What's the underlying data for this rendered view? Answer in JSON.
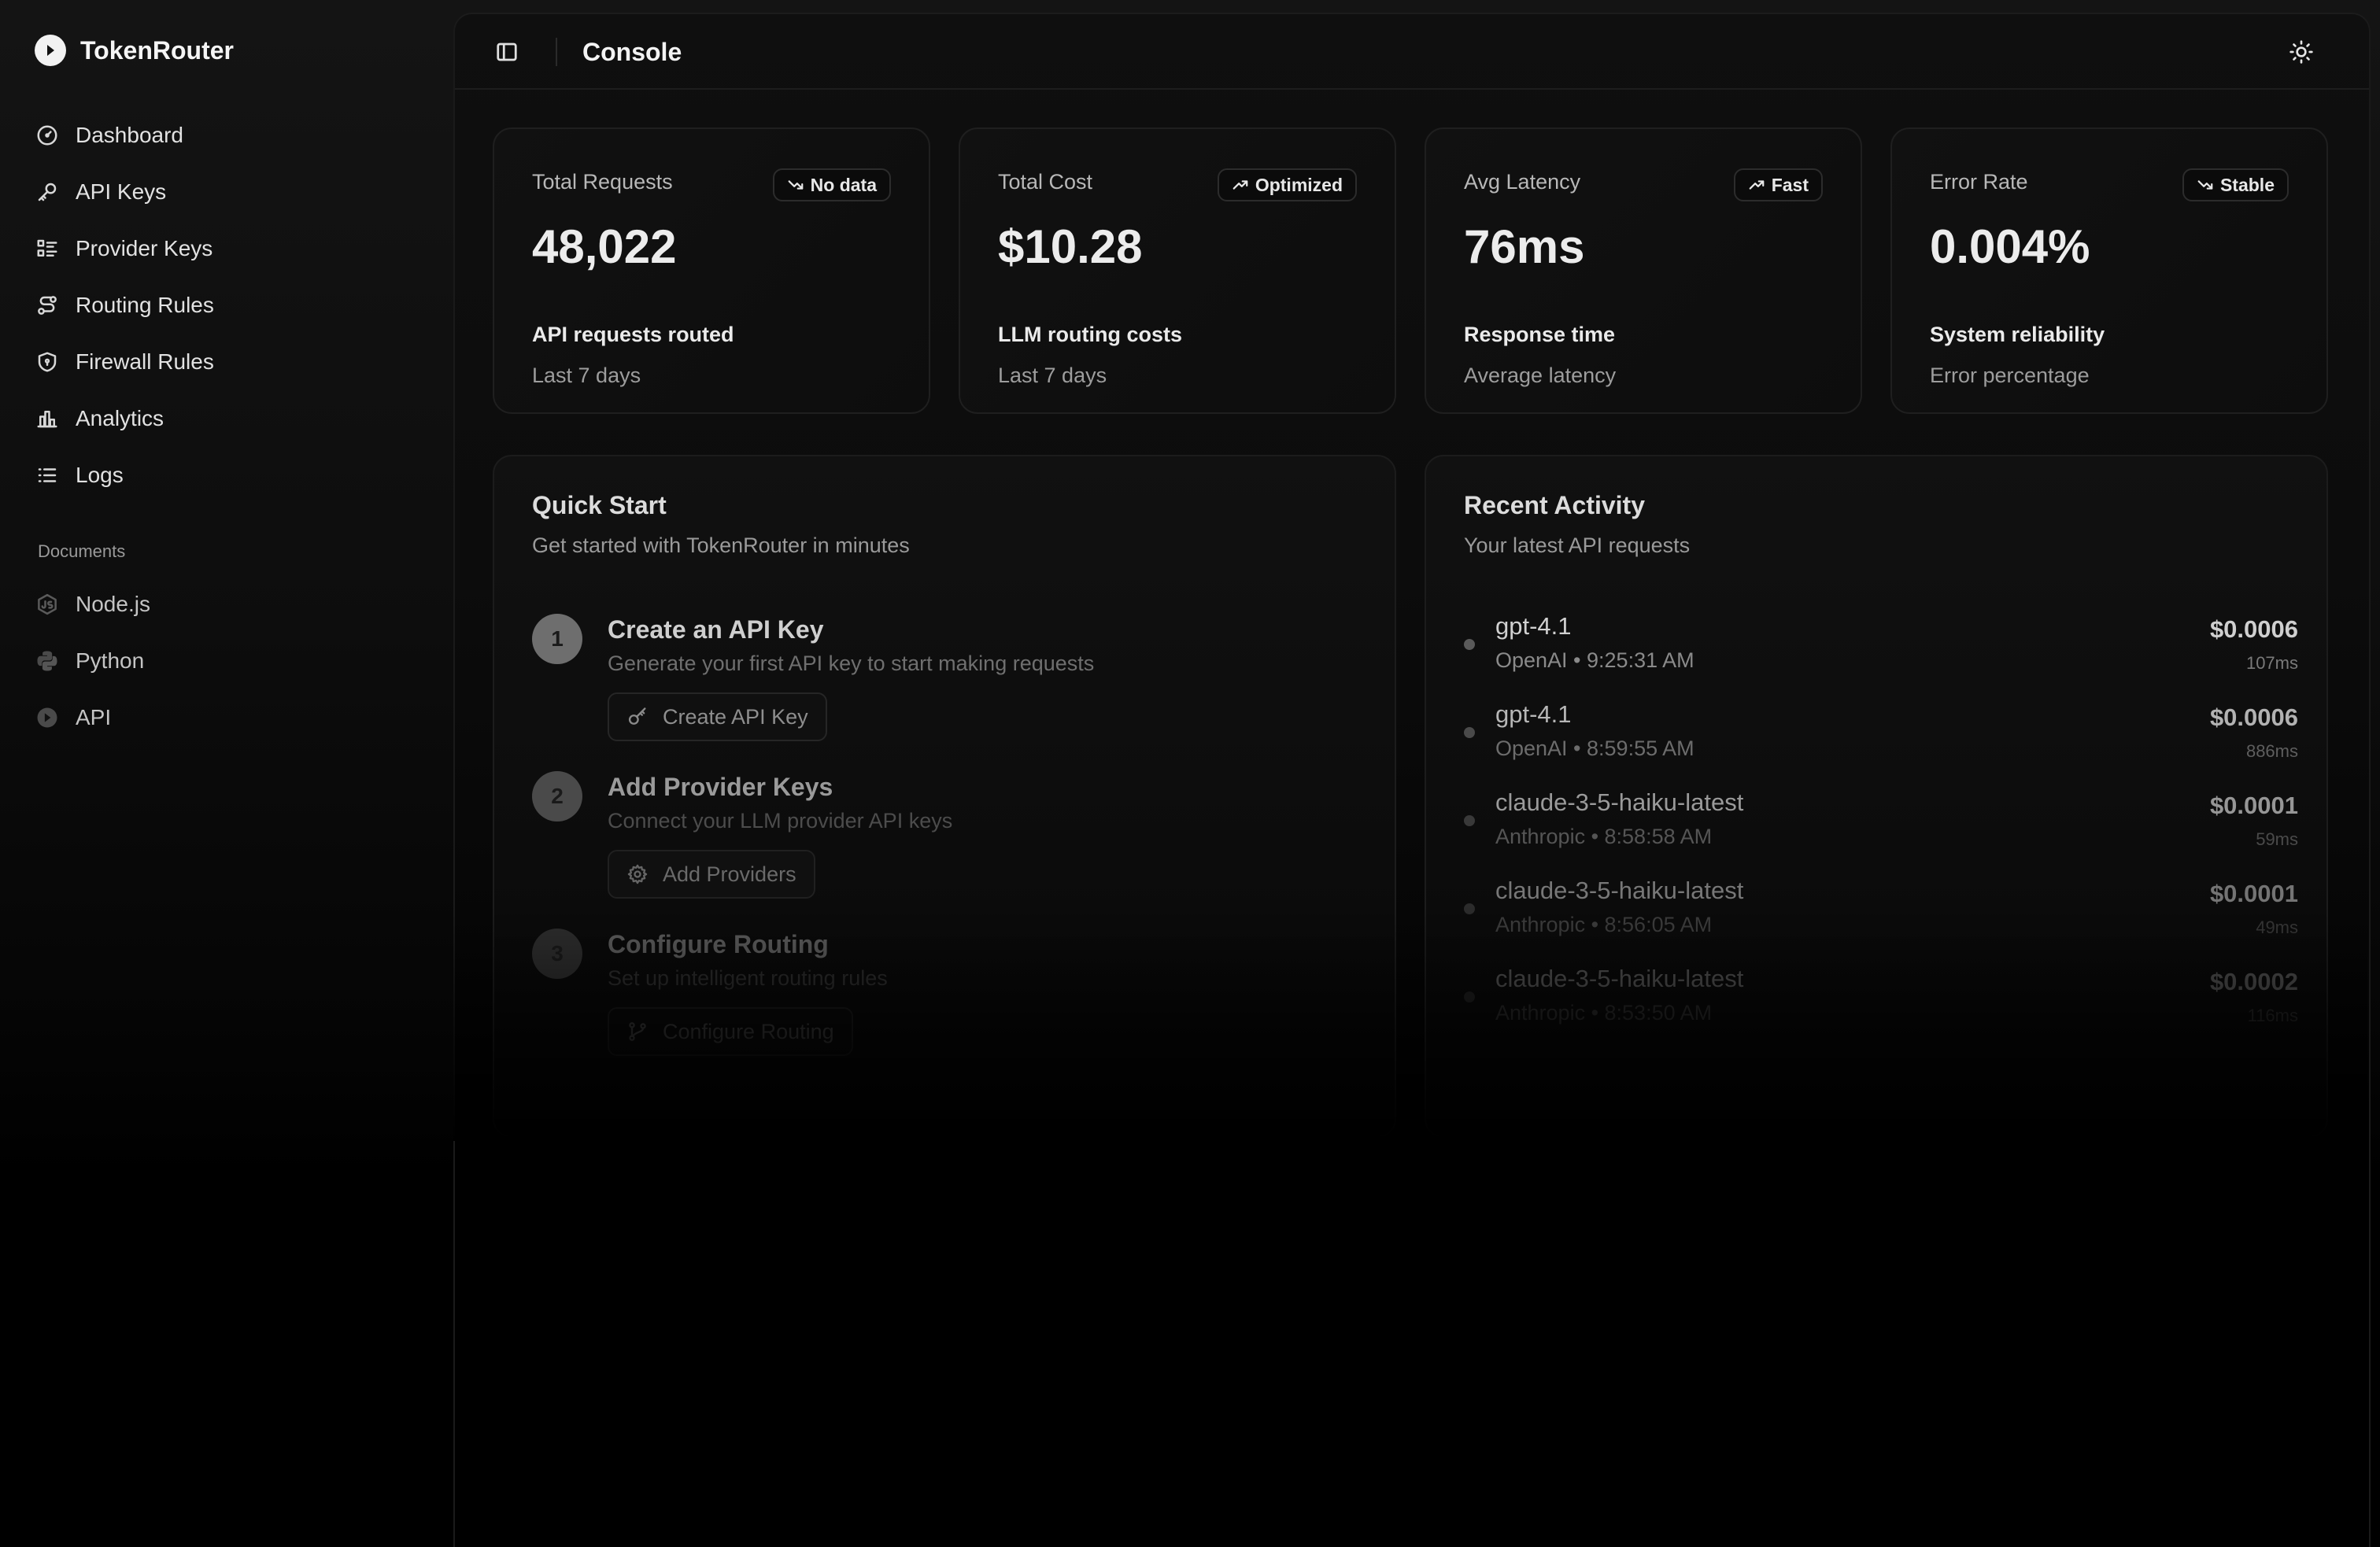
{
  "brand": {
    "name": "TokenRouter"
  },
  "sidebar": {
    "items": [
      {
        "label": "Dashboard",
        "icon": "gauge-icon"
      },
      {
        "label": "API Keys",
        "icon": "key-icon"
      },
      {
        "label": "Provider Keys",
        "icon": "list-key-icon"
      },
      {
        "label": "Routing Rules",
        "icon": "route-icon"
      },
      {
        "label": "Firewall Rules",
        "icon": "shield-icon"
      },
      {
        "label": "Analytics",
        "icon": "bar-chart-icon"
      },
      {
        "label": "Logs",
        "icon": "list-icon"
      }
    ],
    "documents_label": "Documents",
    "documents": [
      {
        "label": "Node.js",
        "icon": "nodejs-icon"
      },
      {
        "label": "Python",
        "icon": "python-icon"
      },
      {
        "label": "API",
        "icon": "api-icon"
      }
    ]
  },
  "header": {
    "title": "Console"
  },
  "stats": [
    {
      "label": "Total Requests",
      "badge": "No data",
      "badge_icon": "trend-down-icon",
      "value": "48,022",
      "desc": "API requests routed",
      "sub": "Last 7 days"
    },
    {
      "label": "Total Cost",
      "badge": "Optimized",
      "badge_icon": "trend-up-icon",
      "value": "$10.28",
      "desc": "LLM routing costs",
      "sub": "Last 7 days"
    },
    {
      "label": "Avg Latency",
      "badge": "Fast",
      "badge_icon": "trend-up-icon",
      "value": "76ms",
      "desc": "Response time",
      "sub": "Average latency"
    },
    {
      "label": "Error Rate",
      "badge": "Stable",
      "badge_icon": "trend-down-icon",
      "value": "0.004%",
      "desc": "System reliability",
      "sub": "Error percentage"
    }
  ],
  "quick_start": {
    "title": "Quick Start",
    "subtitle": "Get started with TokenRouter in minutes",
    "steps": [
      {
        "num": "1",
        "title": "Create an API Key",
        "desc": "Generate your first API key to start making requests",
        "button": "Create API Key",
        "icon": "key-icon"
      },
      {
        "num": "2",
        "title": "Add Provider Keys",
        "desc": "Connect your LLM provider API keys",
        "button": "Add Providers",
        "icon": "gear-icon"
      },
      {
        "num": "3",
        "title": "Configure Routing",
        "desc": "Set up intelligent routing rules",
        "button": "Configure Routing",
        "icon": "git-branch-icon"
      }
    ]
  },
  "recent_activity": {
    "title": "Recent Activity",
    "subtitle": "Your latest API requests",
    "rows": [
      {
        "model": "gpt-4.1",
        "meta": "OpenAI • 9:25:31 AM",
        "cost": "$0.0006",
        "latency": "107ms"
      },
      {
        "model": "gpt-4.1",
        "meta": "OpenAI • 8:59:55 AM",
        "cost": "$0.0006",
        "latency": "886ms"
      },
      {
        "model": "claude-3-5-haiku-latest",
        "meta": "Anthropic • 8:58:58 AM",
        "cost": "$0.0001",
        "latency": "59ms"
      },
      {
        "model": "claude-3-5-haiku-latest",
        "meta": "Anthropic • 8:56:05 AM",
        "cost": "$0.0001",
        "latency": "49ms"
      },
      {
        "model": "claude-3-5-haiku-latest",
        "meta": "Anthropic • 8:53:50 AM",
        "cost": "$0.0002",
        "latency": "116ms"
      }
    ]
  }
}
